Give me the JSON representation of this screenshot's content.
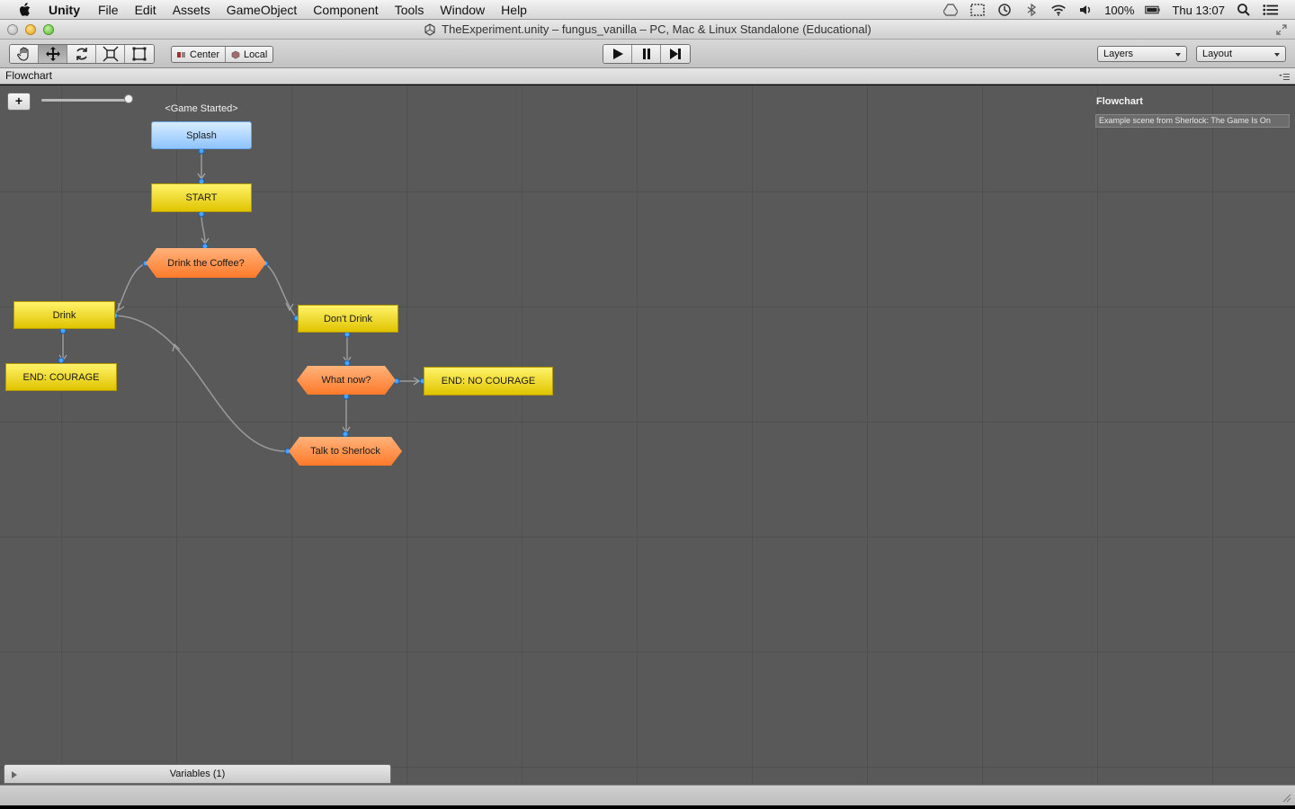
{
  "menubar": {
    "app_name": "Unity",
    "menus": [
      "File",
      "Edit",
      "Assets",
      "GameObject",
      "Component",
      "Tools",
      "Window",
      "Help"
    ],
    "battery": "100%",
    "clock": "Thu 13:07"
  },
  "window": {
    "title": "TheExperiment.unity – fungus_vanilla – PC, Mac & Linux Standalone (Educational)"
  },
  "toolbar": {
    "tools": [
      "hand-tool",
      "move-tool",
      "rotate-tool",
      "scale-tool",
      "rect-tool"
    ],
    "active_tool": "move-tool",
    "pivot_mode": "Center",
    "pivot_rotation": "Local",
    "layers_label": "Layers",
    "layout_label": "Layout"
  },
  "panel": {
    "tab_label": "Flowchart"
  },
  "flowchart": {
    "name": "Flowchart",
    "description": "Example scene from Sherlock: The Game Is On",
    "event_label": "<Game Started>",
    "blocks": {
      "splash": "Splash",
      "start": "START",
      "drink_coffee": "Drink the Coffee?",
      "drink": "Drink",
      "dont_drink": "Don't Drink",
      "end_courage": "END: COURAGE",
      "what_now": "What now?",
      "end_no_courage": "END: NO COURAGE",
      "talk_sherlock": "Talk to Sherlock"
    },
    "variables_label": "Variables (1)"
  },
  "colors": {
    "canvas": "#595959",
    "event_block": "#8ec4ff",
    "command_block": "#f0d400",
    "choice_block": "#ff8a40",
    "connector": "#9a9a9a"
  }
}
